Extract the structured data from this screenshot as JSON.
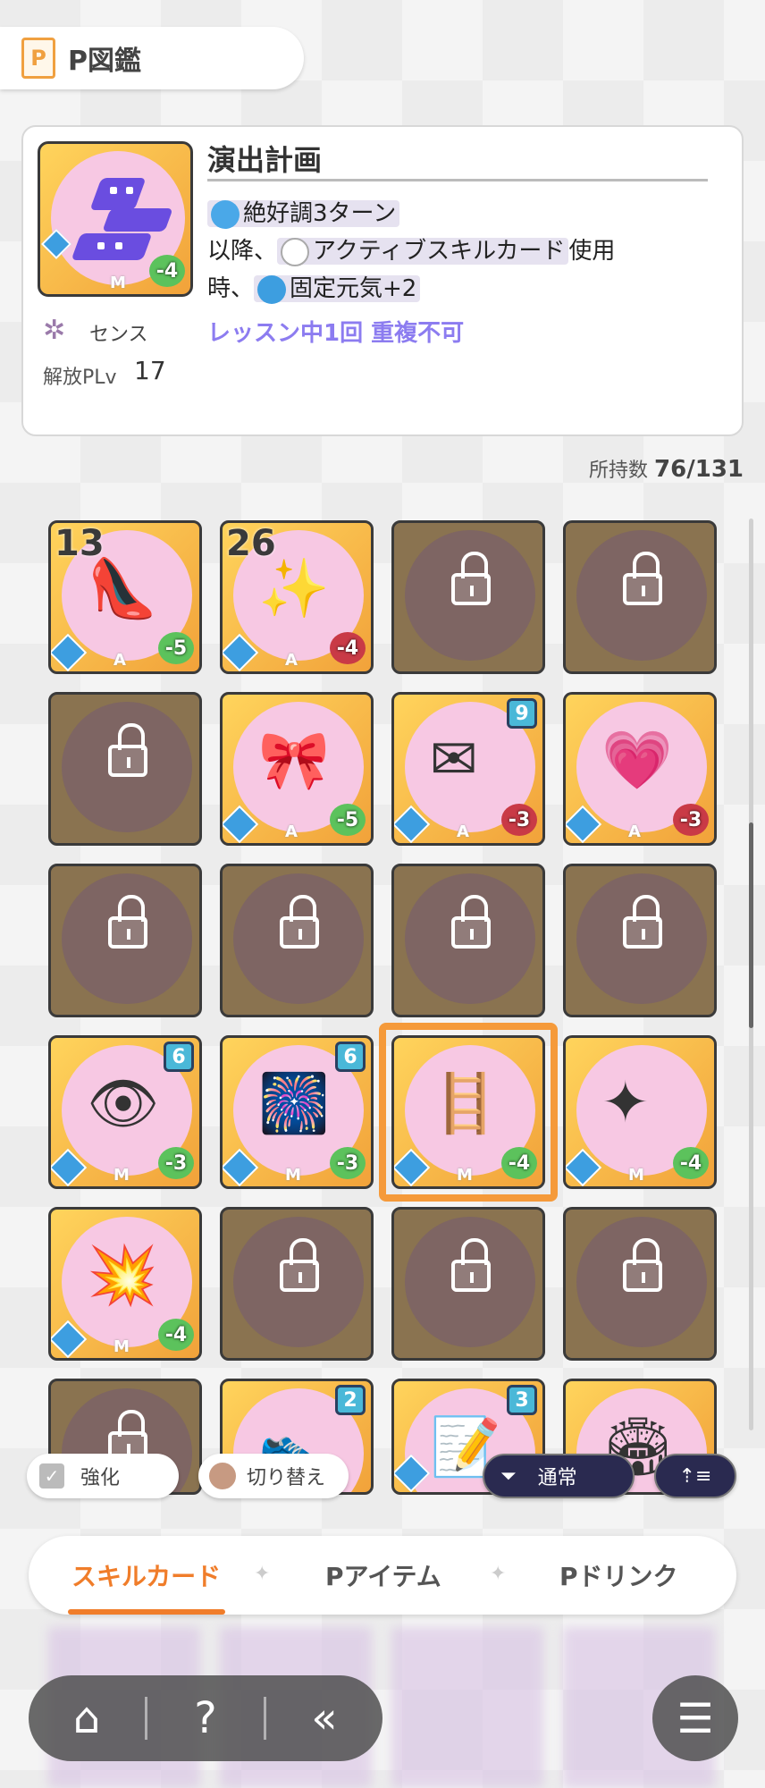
{
  "header": {
    "icon_letter": "P",
    "title": "P図鑑"
  },
  "detail": {
    "name": "演出計画",
    "type": "センス",
    "release_label": "解放PLv",
    "release_level": "17",
    "rarity": "M",
    "cost": "-4",
    "effect_line1": "絶好調3ターン",
    "effect_line2_a": "以降、",
    "effect_line2_b": "アクティブスキルカード",
    "effect_line2_c": "使用",
    "effect_line3_a": "時、",
    "effect_line3_b": "固定元気+2",
    "effect_extra": "レッスン中1回 重複不可"
  },
  "owned": {
    "label": "所持数",
    "value": "76/131"
  },
  "cards": [
    {
      "state": "owned",
      "count": "13",
      "rarity": "A",
      "cost": "-5",
      "cost_color": "green",
      "art": "👠"
    },
    {
      "state": "owned",
      "count": "26",
      "rarity": "A",
      "cost": "-4",
      "cost_color": "red",
      "art": "✨"
    },
    {
      "state": "locked"
    },
    {
      "state": "locked"
    },
    {
      "state": "locked"
    },
    {
      "state": "owned",
      "rarity": "A",
      "cost": "-5",
      "cost_color": "green",
      "art": "🎀"
    },
    {
      "state": "owned",
      "badge": "9",
      "rarity": "A",
      "cost": "-3",
      "cost_color": "red",
      "art": "✉"
    },
    {
      "state": "owned",
      "rarity": "A",
      "cost": "-3",
      "cost_color": "red",
      "art": "💗"
    },
    {
      "state": "locked"
    },
    {
      "state": "locked"
    },
    {
      "state": "locked"
    },
    {
      "state": "locked"
    },
    {
      "state": "owned",
      "badge": "6",
      "rarity": "M",
      "cost": "-3",
      "cost_color": "green",
      "art": "👁"
    },
    {
      "state": "owned",
      "badge": "6",
      "rarity": "M",
      "cost": "-3",
      "cost_color": "green",
      "art": "🎆"
    },
    {
      "state": "owned",
      "rarity": "M",
      "cost": "-4",
      "cost_color": "green",
      "art": "🪜",
      "selected": true
    },
    {
      "state": "owned",
      "rarity": "M",
      "cost": "-4",
      "cost_color": "green",
      "art": "✦"
    },
    {
      "state": "owned",
      "rarity": "M",
      "cost": "-4",
      "cost_color": "green",
      "art": "💥"
    },
    {
      "state": "locked"
    },
    {
      "state": "locked"
    },
    {
      "state": "locked"
    },
    {
      "state": "locked"
    },
    {
      "state": "owned",
      "badge": "2",
      "art": "👟"
    },
    {
      "state": "owned",
      "badge": "3",
      "art": "📝"
    },
    {
      "state": "owned",
      "art": "🏟"
    }
  ],
  "controls": {
    "enhance_label": "強化",
    "toggle_label": "切り替え",
    "filter_label": "通常",
    "sort_icon": "sort-ascending-icon"
  },
  "tabs": [
    {
      "label": "スキルカード",
      "active": true
    },
    {
      "label": "Pアイテム",
      "active": false
    },
    {
      "label": "Pドリンク",
      "active": false
    }
  ],
  "tab_separator": "✦",
  "nav": {
    "home_icon": "home-icon",
    "help_icon": "help-icon",
    "back_icon": "back-icon",
    "menu_icon": "menu-icon"
  },
  "colors": {
    "accent": "#f07d2a",
    "effect_extra": "#8c7cf0",
    "card_gold": "#f1a23a"
  }
}
